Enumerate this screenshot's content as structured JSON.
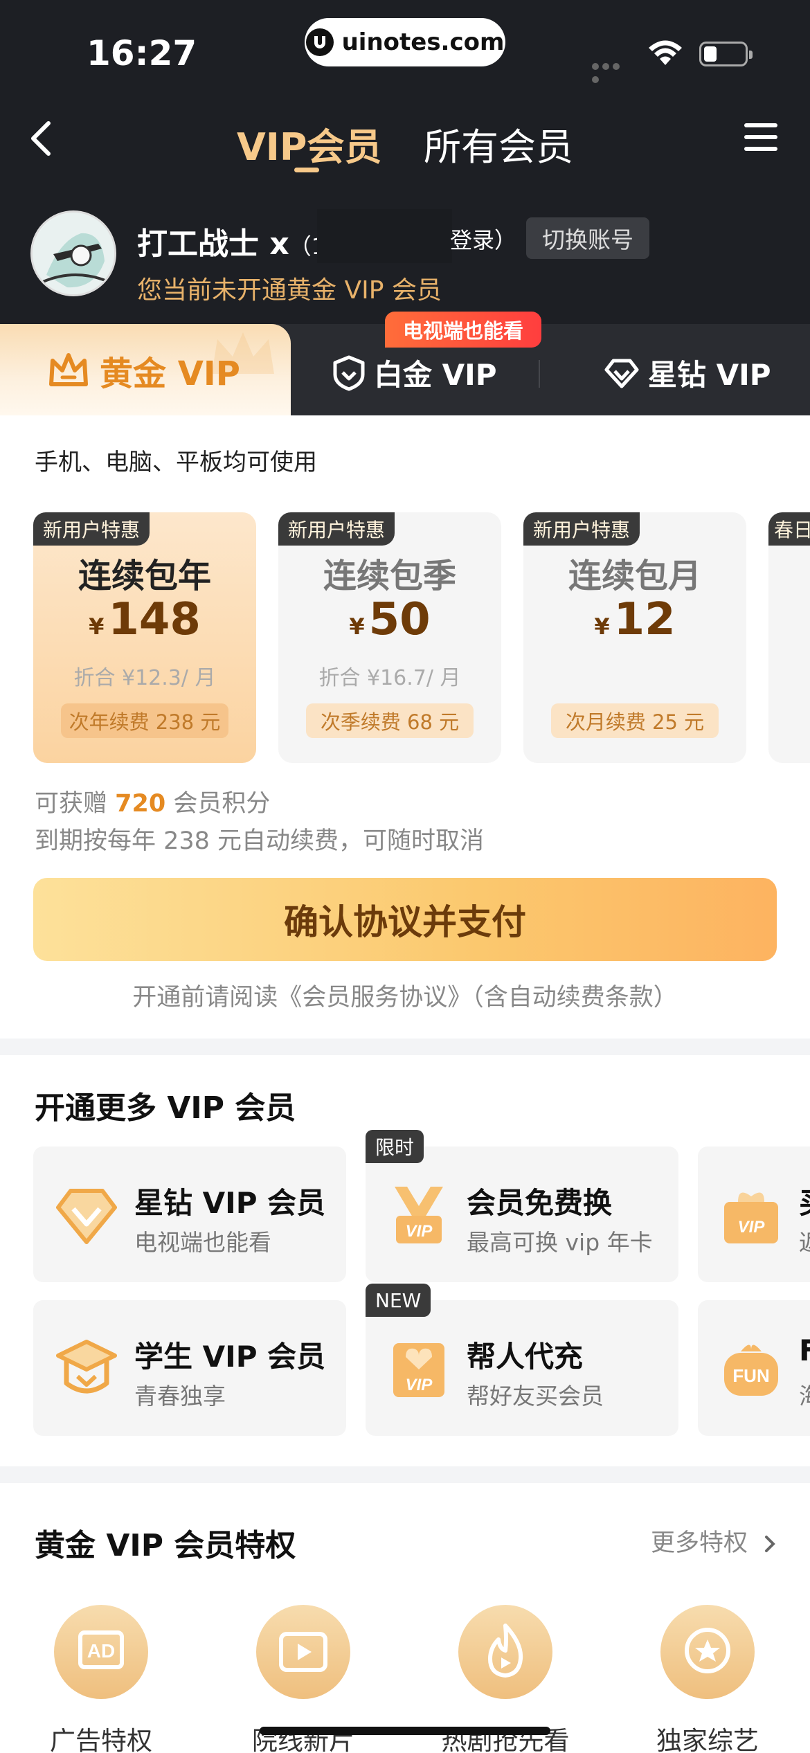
{
  "status_bar": {
    "time": "16:27",
    "url": "uinotes.com"
  },
  "nav": {
    "tabs": [
      "VIP会员",
      "所有会员"
    ]
  },
  "user": {
    "name": "打工战士 x",
    "login_prefix": "（1",
    "login_suffix": "登录）",
    "switch_label": "切换账号",
    "status": "您当前未开通黄金 VIP 会员"
  },
  "tiers": [
    {
      "label": "黄金 VIP",
      "icon": "crown-icon"
    },
    {
      "label": "白金 VIP",
      "icon": "shield-icon"
    },
    {
      "label": "星钻 VIP",
      "icon": "diamond-icon"
    }
  ],
  "tier_badge": "电视端也能看",
  "devices_text": "手机、电脑、平板均可使用",
  "plans": [
    {
      "tag": "新用户特惠",
      "name": "连续包年",
      "currency": "¥",
      "price": "148",
      "per": "折合 ¥12.3/ 月",
      "renew": "次年续费 238 元",
      "selected": true
    },
    {
      "tag": "新用户特惠",
      "name": "连续包季",
      "currency": "¥",
      "price": "50",
      "per": "折合 ¥16.7/ 月",
      "renew": "次季续费 68 元",
      "selected": false
    },
    {
      "tag": "新用户特惠",
      "name": "连续包月",
      "currency": "¥",
      "price": "12",
      "per": "",
      "renew": "次月续费 25 元",
      "selected": false
    },
    {
      "tag": "春日",
      "name": "",
      "currency": "",
      "price": "",
      "per": "",
      "renew": "",
      "selected": false
    }
  ],
  "points": {
    "prefix": "可获赠 ",
    "value": "720",
    "suffix": " 会员积分"
  },
  "auto_renew_text": "到期按每年 238 元自动续费，可随时取消",
  "pay_button": "确认协议并支付",
  "agreement_text": "开通前请阅读《会员服务协议》（含自动续费条款）",
  "more_vip": {
    "title": "开通更多 VIP 会员",
    "cards": [
      {
        "title": "星钻 VIP 会员",
        "sub": "电视端也能看",
        "tag": ""
      },
      {
        "title": "会员免费换",
        "sub": "最高可换 vip 年卡",
        "tag": "限时"
      },
      {
        "title": "买",
        "sub": "返",
        "tag": ""
      },
      {
        "title": "学生 VIP 会员",
        "sub": "青春独享",
        "tag": ""
      },
      {
        "title": "帮人代充",
        "sub": "帮好友买会员",
        "tag": "NEW"
      },
      {
        "title": "F",
        "sub": "海",
        "tag": ""
      }
    ]
  },
  "privileges": {
    "title": "黄金 VIP 会员特权",
    "more": "更多特权",
    "items": [
      "广告特权",
      "院线新片",
      "热剧抢先看",
      "独家综艺"
    ]
  },
  "colors": {
    "accent_gold": "#f7c98a",
    "dark_bg": "#1d1f24",
    "price_brown": "#6e3b08",
    "orange": "#e58a22"
  }
}
